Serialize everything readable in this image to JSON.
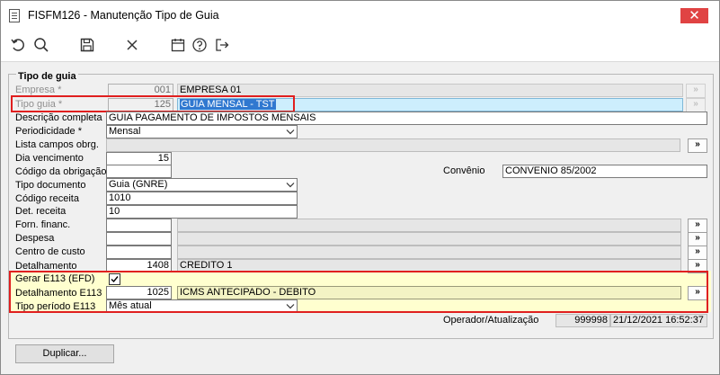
{
  "window": {
    "title": "FISFM126 - Manutenção Tipo de Guia",
    "close_glyph": "✕"
  },
  "toolbar": {
    "icons": [
      "undo-icon",
      "search-icon",
      "save-icon",
      "cancel-icon",
      "calendar-icon",
      "help-icon",
      "exit-icon"
    ]
  },
  "group": {
    "title": "Tipo de guia"
  },
  "fields": {
    "empresa": {
      "label": "Empresa *",
      "code": "001",
      "desc": "EMPRESA 01"
    },
    "tipo_guia": {
      "label": "Tipo guia *",
      "code": "125",
      "desc": "GUIA MENSAL - TST"
    },
    "descricao": {
      "label": "Descrição completa",
      "value": "GUIA PAGAMENTO DE IMPOSTOS MENSAIS"
    },
    "periodicidade": {
      "label": "Periodicidade *",
      "value": "Mensal"
    },
    "lista_campos": {
      "label": "Lista campos obrg.",
      "value": ""
    },
    "dia_vencimento": {
      "label": "Dia vencimento",
      "value": "15"
    },
    "codigo_obrigacao": {
      "label": "Código da obrigação",
      "value": ""
    },
    "convenio": {
      "label": "Convênio",
      "value": "CONVENIO 85/2002"
    },
    "tipo_documento": {
      "label": "Tipo documento",
      "value": "Guia (GNRE)"
    },
    "codigo_receita": {
      "label": "Código receita",
      "value": "1010"
    },
    "det_receita": {
      "label": "Det. receita",
      "value": "10"
    },
    "forn_financ": {
      "label": "Forn. financ.",
      "code": "",
      "desc": ""
    },
    "despesa": {
      "label": "Despesa",
      "code": "",
      "desc": ""
    },
    "centro_custo": {
      "label": "Centro de custo",
      "code": "",
      "desc": ""
    },
    "detalhamento": {
      "label": "Detalhamento",
      "code": "1408",
      "desc": "CREDITO 1"
    },
    "gerar_e113": {
      "label": "Gerar E113 (EFD)",
      "checked": true
    },
    "detalhamento_e113": {
      "label": "Detalhamento E113",
      "code": "1025",
      "desc": "ICMS ANTECIPADO - DEBITO"
    },
    "tipo_periodo_e113": {
      "label": "Tipo período E113",
      "value": "Mês atual"
    },
    "operador": {
      "label": "Operador/Atualização",
      "code": "999998",
      "datetime": "21/12/2021 16:52:37"
    }
  },
  "lookup_glyph": "»",
  "buttons": {
    "duplicar": "Duplicar..."
  },
  "colors": {
    "highlight_border": "#e01f1f",
    "selection": "#3078d0",
    "yellow_band": "#ffffcf"
  }
}
